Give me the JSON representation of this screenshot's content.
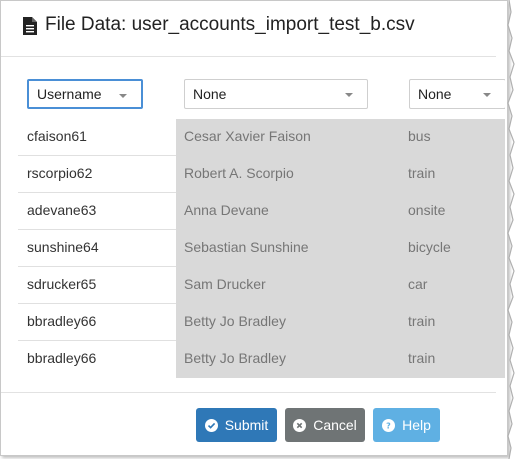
{
  "dialog": {
    "title": "File Data: user_accounts_import_test_b.csv"
  },
  "columns": [
    {
      "selected": "Username"
    },
    {
      "selected": "None"
    },
    {
      "selected": "None"
    }
  ],
  "rows": [
    [
      "cfaison61",
      "Cesar Xavier Faison",
      "bus"
    ],
    [
      "rscorpio62",
      "Robert A. Scorpio",
      "train"
    ],
    [
      "adevane63",
      "Anna Devane",
      "onsite"
    ],
    [
      "sunshine64",
      "Sebastian Sunshine",
      "bicycle"
    ],
    [
      "sdrucker65",
      "Sam Drucker",
      "car"
    ],
    [
      "bbradley66",
      "Betty Jo Bradley",
      "train"
    ],
    [
      "bbradley66",
      "Betty Jo Bradley",
      "train"
    ]
  ],
  "buttons": {
    "submit": "Submit",
    "cancel": "Cancel",
    "help": "Help"
  },
  "icons": {
    "file": "file-icon",
    "submit": "check-circle-icon",
    "cancel": "x-circle-icon",
    "help": "question-circle-icon"
  },
  "colors": {
    "submit": "#2f78b7",
    "cancel": "#6f7475",
    "help": "#5fb0e3",
    "active_select_border": "#4a8fd6",
    "ignored_column_bg": "#d9d9d9"
  }
}
